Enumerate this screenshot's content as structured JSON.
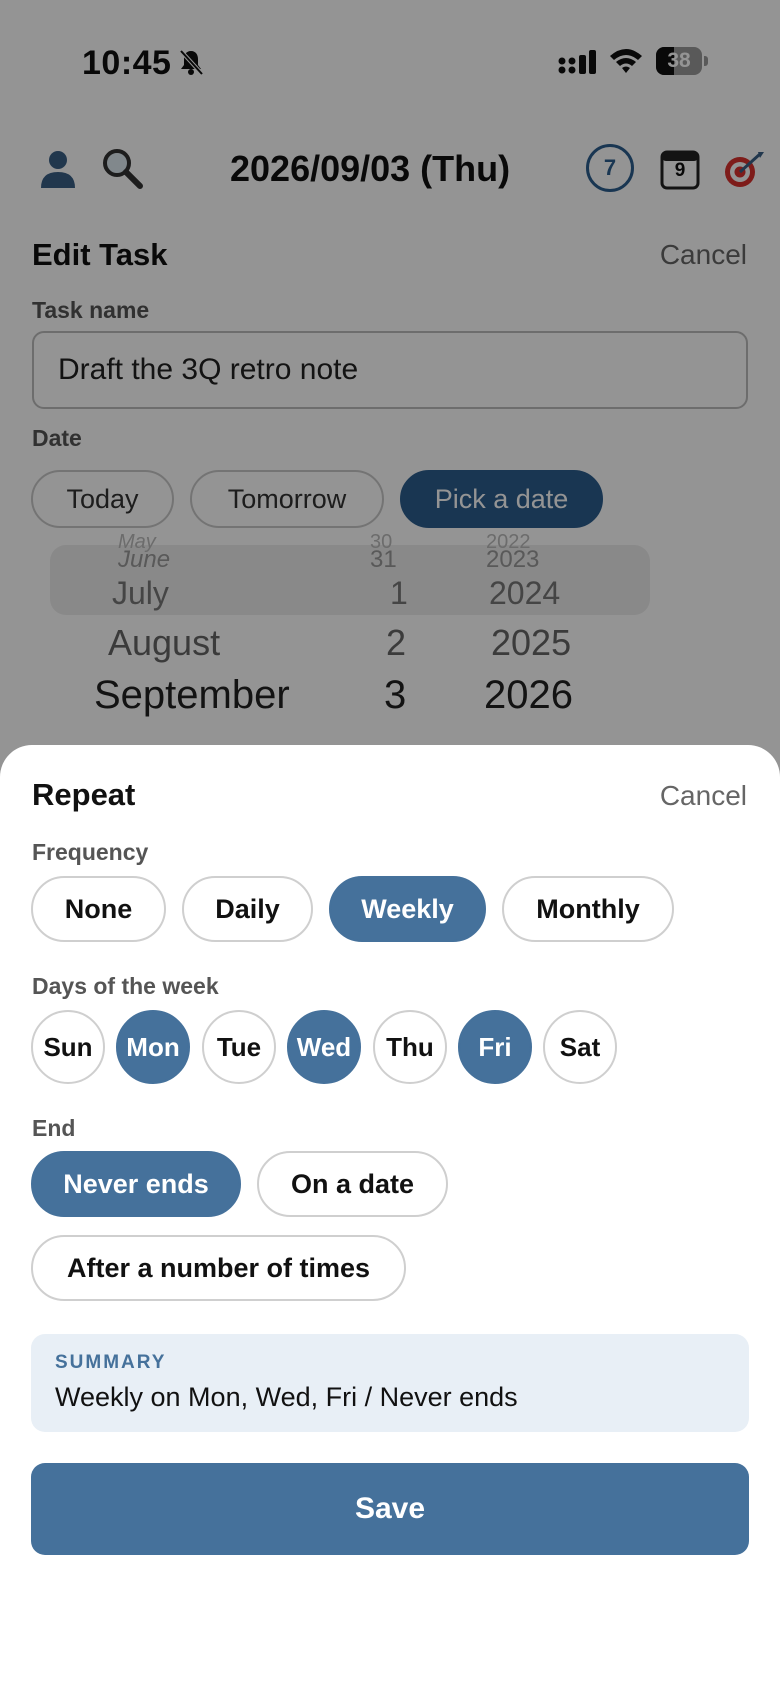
{
  "status_bar": {
    "time": "10:45",
    "battery": "38"
  },
  "header": {
    "date": "2026/09/03 (Thu)",
    "week_badge": "7",
    "calendar_day": "9"
  },
  "edit_task": {
    "title": "Edit Task",
    "cancel_label": "Cancel",
    "task_name_label": "Task name",
    "task_name_value": "Draft the 3Q retro note",
    "date_label": "Date",
    "date_options": [
      "Today",
      "Tomorrow",
      "Pick a date"
    ],
    "date_selected": "Pick a date",
    "picker": {
      "months": [
        "May",
        "June",
        "July",
        "August",
        "September"
      ],
      "days": [
        "30",
        "31",
        "1",
        "2",
        "3"
      ],
      "years": [
        "2022",
        "2023",
        "2024",
        "2025",
        "2026"
      ]
    }
  },
  "repeat": {
    "title": "Repeat",
    "cancel_label": "Cancel",
    "frequency_label": "Frequency",
    "frequency_options": [
      "None",
      "Daily",
      "Weekly",
      "Monthly"
    ],
    "frequency_selected": "Weekly",
    "days_label": "Days of the week",
    "days": [
      "Sun",
      "Mon",
      "Tue",
      "Wed",
      "Thu",
      "Fri",
      "Sat"
    ],
    "days_selected": [
      "Mon",
      "Wed",
      "Fri"
    ],
    "end_label": "End",
    "end_options": [
      "Never ends",
      "On a date",
      "After a number of times"
    ],
    "end_selected": "Never ends",
    "summary_label": "SUMMARY",
    "summary_text": "Weekly on Mon, Wed, Fri / Never ends",
    "save_label": "Save"
  },
  "colors": {
    "accent": "#45719b",
    "accent_dark": "#2c5e8e",
    "summary_bg": "#e8eff6"
  }
}
